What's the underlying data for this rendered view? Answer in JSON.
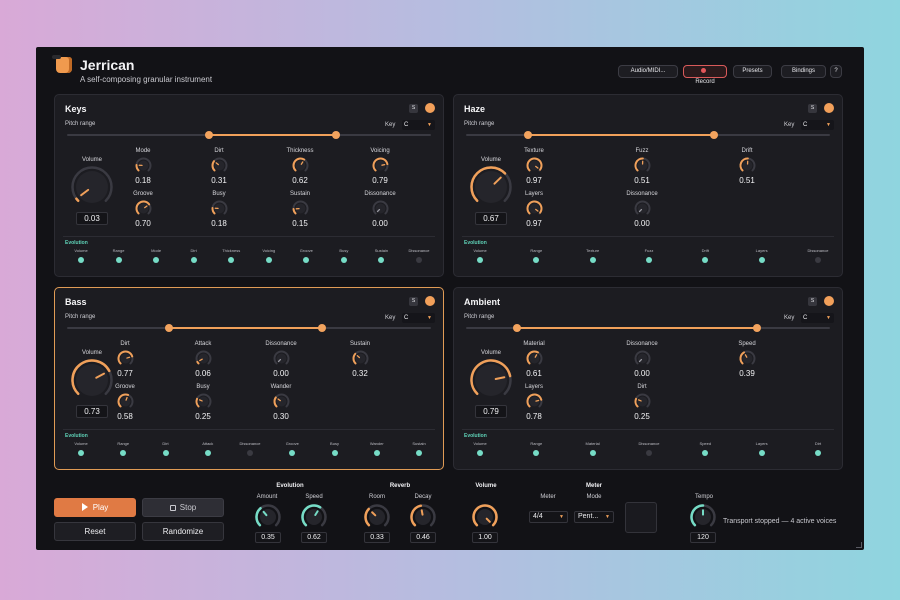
{
  "app": {
    "title": "Jerrican",
    "subtitle": "A self-composing granular instrument",
    "accent": "#f0a05a",
    "evolution_color": "#76dcc6"
  },
  "header": {
    "audio_midi": "Audio/MIDI...",
    "record": "Record",
    "presets": "Presets",
    "bindings": "Bindings",
    "help": "?"
  },
  "panels": [
    {
      "name": "Keys",
      "selected": false,
      "solo": "S",
      "pitch_label": "Pitch range",
      "key_label": "Key",
      "key": "C",
      "range": [
        0.39,
        0.74
      ],
      "volume": {
        "label": "Volume",
        "value": "0.03",
        "level": 0.03
      },
      "knobs": [
        {
          "label": "Mode",
          "value": "0.18",
          "level": 0.18
        },
        {
          "label": "Dirt",
          "value": "0.31",
          "level": 0.31
        },
        {
          "label": "Thickness",
          "value": "0.62",
          "level": 0.62
        },
        {
          "label": "Voicing",
          "value": "0.79",
          "level": 0.79
        },
        {
          "label": "Groove",
          "value": "0.70",
          "level": 0.7
        },
        {
          "label": "Busy",
          "value": "0.18",
          "level": 0.18
        },
        {
          "label": "Sustain",
          "value": "0.15",
          "level": 0.15
        },
        {
          "label": "Dissonance",
          "value": "0.00",
          "level": 0.0
        }
      ],
      "evolution_title": "Evolution",
      "evolution": [
        {
          "label": "Volume",
          "on": true
        },
        {
          "label": "Range",
          "on": true
        },
        {
          "label": "Mode",
          "on": true
        },
        {
          "label": "Dirt",
          "on": true
        },
        {
          "label": "Thickness",
          "on": true
        },
        {
          "label": "Voicing",
          "on": true
        },
        {
          "label": "Groove",
          "on": true
        },
        {
          "label": "Busy",
          "on": true
        },
        {
          "label": "Sustain",
          "on": true
        },
        {
          "label": "Dissonance",
          "on": false
        }
      ]
    },
    {
      "name": "Haze",
      "selected": false,
      "solo": "S",
      "pitch_label": "Pitch range",
      "key_label": "Key",
      "key": "C",
      "range": [
        0.17,
        0.68
      ],
      "volume": {
        "label": "Volume",
        "value": "0.67",
        "level": 0.67
      },
      "knobs": [
        {
          "label": "Texture",
          "value": "0.97",
          "level": 0.97
        },
        {
          "label": "Fuzz",
          "value": "0.51",
          "level": 0.51
        },
        {
          "label": "Drift",
          "value": "0.51",
          "level": 0.51
        },
        {
          "label": "Layers",
          "value": "0.97",
          "level": 0.97
        },
        {
          "label": "Dissonance",
          "value": "0.00",
          "level": 0.0
        }
      ],
      "evolution_title": "Evolution",
      "evolution": [
        {
          "label": "Volume",
          "on": true
        },
        {
          "label": "Range",
          "on": true
        },
        {
          "label": "Texture",
          "on": true
        },
        {
          "label": "Fuzz",
          "on": true
        },
        {
          "label": "Drift",
          "on": true
        },
        {
          "label": "Layers",
          "on": true
        },
        {
          "label": "Dissonance",
          "on": false
        }
      ]
    },
    {
      "name": "Bass",
      "selected": true,
      "solo": "S",
      "pitch_label": "Pitch range",
      "key_label": "Key",
      "key": "C",
      "range": [
        0.28,
        0.7
      ],
      "volume": {
        "label": "Volume",
        "value": "0.73",
        "level": 0.73
      },
      "knobs": [
        {
          "label": "Dirt",
          "value": "0.77",
          "level": 0.77
        },
        {
          "label": "Attack",
          "value": "0.06",
          "level": 0.06
        },
        {
          "label": "Dissonance",
          "value": "0.00",
          "level": 0.0
        },
        {
          "label": "Sustain",
          "value": "0.32",
          "level": 0.32
        },
        {
          "label": "Groove",
          "value": "0.58",
          "level": 0.58
        },
        {
          "label": "Busy",
          "value": "0.25",
          "level": 0.25
        },
        {
          "label": "Wander",
          "value": "0.30",
          "level": 0.3
        }
      ],
      "evolution_title": "Evolution",
      "evolution": [
        {
          "label": "Volume",
          "on": true
        },
        {
          "label": "Range",
          "on": true
        },
        {
          "label": "Dirt",
          "on": true
        },
        {
          "label": "Attack",
          "on": true
        },
        {
          "label": "Dissonance",
          "on": false
        },
        {
          "label": "Groove",
          "on": true
        },
        {
          "label": "Busy",
          "on": true
        },
        {
          "label": "Wander",
          "on": true
        },
        {
          "label": "Sustain",
          "on": true
        }
      ]
    },
    {
      "name": "Ambient",
      "selected": false,
      "solo": "S",
      "pitch_label": "Pitch range",
      "key_label": "Key",
      "key": "C",
      "range": [
        0.14,
        0.8
      ],
      "volume": {
        "label": "Volume",
        "value": "0.79",
        "level": 0.79
      },
      "knobs": [
        {
          "label": "Material",
          "value": "0.61",
          "level": 0.61
        },
        {
          "label": "Dissonance",
          "value": "0.00",
          "level": 0.0
        },
        {
          "label": "Speed",
          "value": "0.39",
          "level": 0.39
        },
        {
          "label": "Layers",
          "value": "0.78",
          "level": 0.78
        },
        {
          "label": "Dirt",
          "value": "0.25",
          "level": 0.25
        }
      ],
      "evolution_title": "Evolution",
      "evolution": [
        {
          "label": "Volume",
          "on": true
        },
        {
          "label": "Range",
          "on": true
        },
        {
          "label": "Material",
          "on": true
        },
        {
          "label": "Dissonance",
          "on": false
        },
        {
          "label": "Speed",
          "on": true
        },
        {
          "label": "Layers",
          "on": true
        },
        {
          "label": "Dirt",
          "on": true
        }
      ]
    }
  ],
  "transport": {
    "play": "Play",
    "stop": "Stop",
    "reset": "Reset",
    "randomize": "Randomize",
    "evolution": {
      "title": "Evolution",
      "amount": {
        "label": "Amount",
        "value": "0.35",
        "level": 0.35
      },
      "speed": {
        "label": "Speed",
        "value": "0.62",
        "level": 0.62
      }
    },
    "reverb": {
      "title": "Reverb",
      "room": {
        "label": "Room",
        "value": "0.33",
        "level": 0.33
      },
      "decay": {
        "label": "Decay",
        "value": "0.46",
        "level": 0.46
      }
    },
    "volume": {
      "title": "Volume",
      "value": "1.00",
      "level": 1.0
    },
    "meter": {
      "title": "Meter",
      "meter_label": "Meter",
      "meter_value": "4/4",
      "mode_label": "Mode",
      "mode_value": "Pent..."
    },
    "tempo": {
      "label": "Tempo",
      "value": "120",
      "level": 0.5
    },
    "status": "Transport stopped — 4 active voices"
  }
}
